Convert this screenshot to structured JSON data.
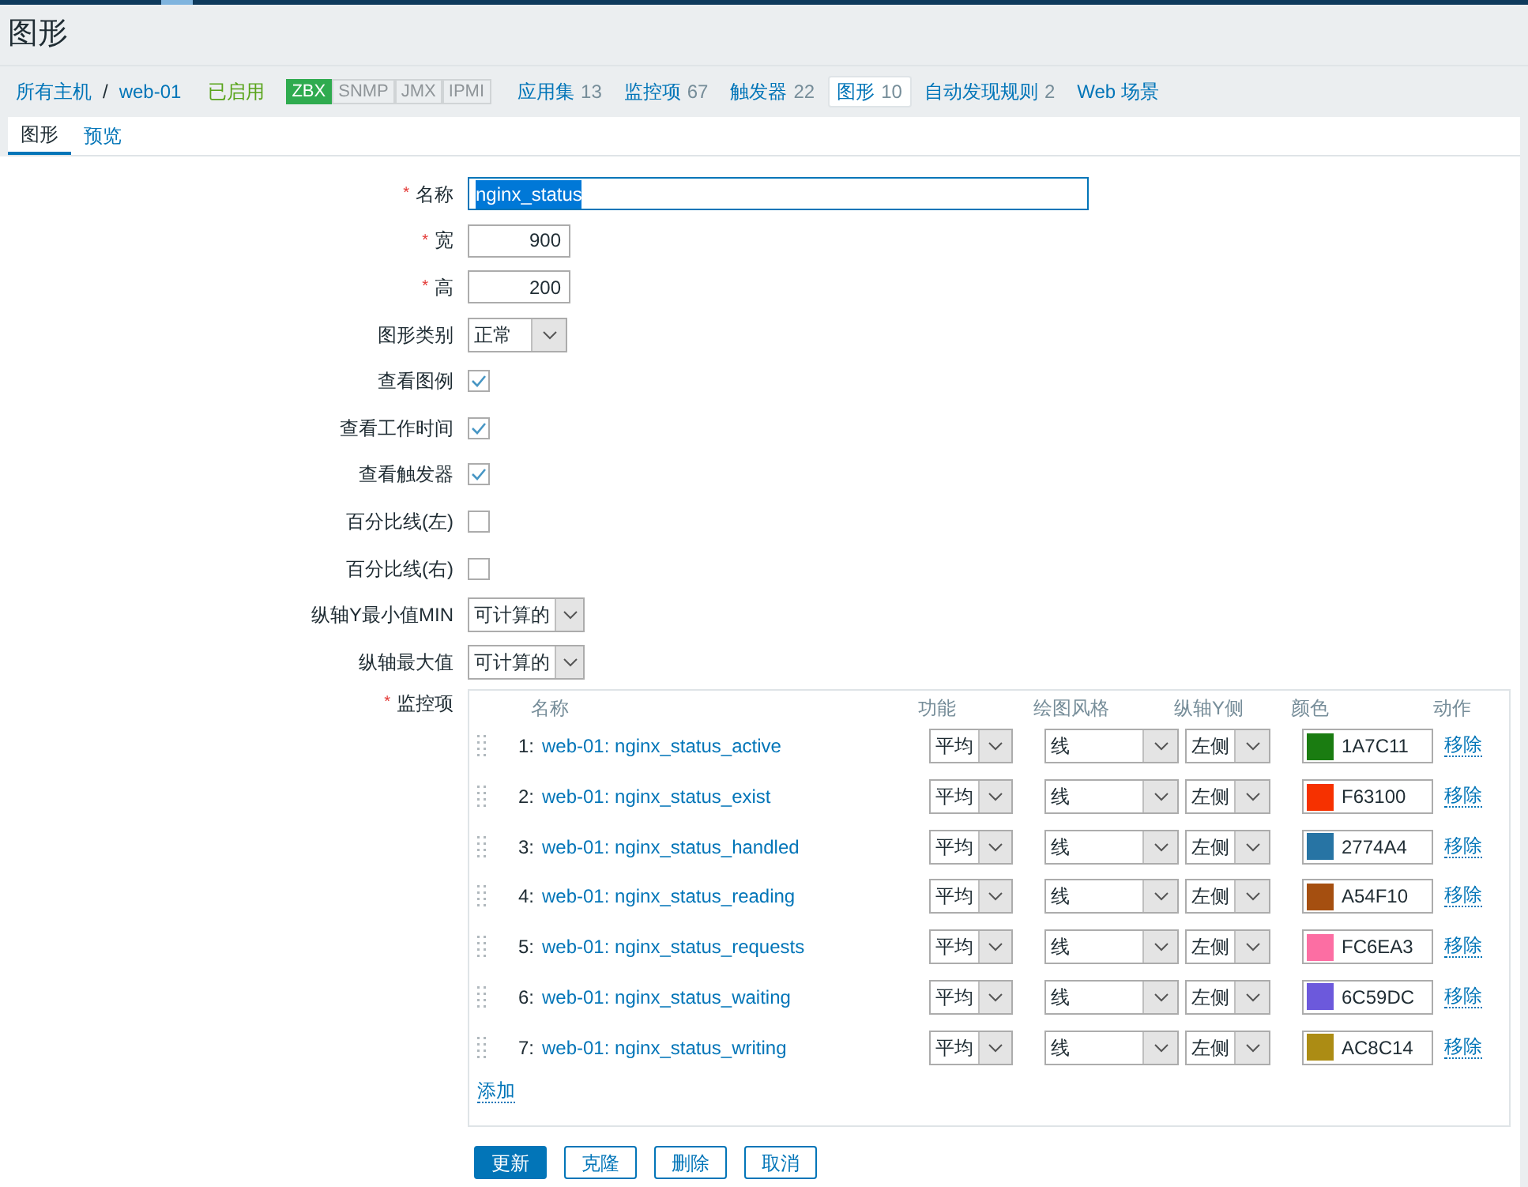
{
  "page_title": "图形",
  "required_mark": "*",
  "nav": {
    "breadcrumbs": [
      {
        "label": "所有主机"
      },
      {
        "label": "web-01"
      }
    ],
    "separator": "/",
    "status": "已启用",
    "availability": [
      {
        "label": "ZBX",
        "active": true
      },
      {
        "label": "SNMP",
        "active": false
      },
      {
        "label": "JMX",
        "active": false
      },
      {
        "label": "IPMI",
        "active": false
      }
    ],
    "links": [
      {
        "label": "应用集",
        "count": "13",
        "selected": false
      },
      {
        "label": "监控项",
        "count": "67",
        "selected": false
      },
      {
        "label": "触发器",
        "count": "22",
        "selected": false
      },
      {
        "label": "图形",
        "count": "10",
        "selected": true
      },
      {
        "label": "自动发现规则",
        "count": "2",
        "selected": false
      },
      {
        "label": "Web 场景",
        "selected": false
      }
    ]
  },
  "tabs": [
    {
      "label": "图形",
      "selected": true
    },
    {
      "label": "预览",
      "selected": false
    }
  ],
  "fields": [
    {
      "kind": "text",
      "label": "名称",
      "required": true,
      "value": "nginx_status",
      "highlighted": true
    },
    {
      "kind": "number",
      "label": "宽",
      "required": true,
      "value": "900",
      "highlighted": false
    },
    {
      "kind": "number",
      "label": "高",
      "required": true,
      "value": "200",
      "highlighted": false
    },
    {
      "kind": "select",
      "label": "图形类别",
      "required": false,
      "value": "正常"
    },
    {
      "kind": "checkbox",
      "label": "查看图例",
      "required": false,
      "checked": true
    },
    {
      "kind": "checkbox",
      "label": "查看工作时间",
      "required": false,
      "checked": true
    },
    {
      "kind": "checkbox",
      "label": "查看触发器",
      "required": false,
      "checked": true
    },
    {
      "kind": "checkbox",
      "label": "百分比线(左)",
      "required": false,
      "checked": false
    },
    {
      "kind": "checkbox",
      "label": "百分比线(右)",
      "required": false,
      "checked": false
    },
    {
      "kind": "select",
      "label": "纵轴Y最小值MIN",
      "required": false,
      "value": "可计算的"
    },
    {
      "kind": "select",
      "label": "纵轴最大值",
      "required": false,
      "value": "可计算的"
    }
  ],
  "items": {
    "label": "监控项",
    "required": true,
    "columns": [
      "名称",
      "功能",
      "绘图风格",
      "纵轴Y侧",
      "颜色",
      "动作"
    ],
    "rows": [
      {
        "index": "1:",
        "name": "web-01: nginx_status_active",
        "function": "平均",
        "style": "线",
        "axis": "左侧",
        "color": "#1a7c11",
        "color_code": "1A7C11",
        "action": "移除"
      },
      {
        "index": "2:",
        "name": "web-01: nginx_status_exist",
        "function": "平均",
        "style": "线",
        "axis": "左侧",
        "color": "#f63100",
        "color_code": "F63100",
        "action": "移除"
      },
      {
        "index": "3:",
        "name": "web-01: nginx_status_handled",
        "function": "平均",
        "style": "线",
        "axis": "左侧",
        "color": "#2774a4",
        "color_code": "2774A4",
        "action": "移除"
      },
      {
        "index": "4:",
        "name": "web-01: nginx_status_reading",
        "function": "平均",
        "style": "线",
        "axis": "左侧",
        "color": "#a54f10",
        "color_code": "A54F10",
        "action": "移除"
      },
      {
        "index": "5:",
        "name": "web-01: nginx_status_requests",
        "function": "平均",
        "style": "线",
        "axis": "左侧",
        "color": "#fc6ea3",
        "color_code": "FC6EA3",
        "action": "移除"
      },
      {
        "index": "6:",
        "name": "web-01: nginx_status_waiting",
        "function": "平均",
        "style": "线",
        "axis": "左侧",
        "color": "#6c59dc",
        "color_code": "6C59DC",
        "action": "移除"
      },
      {
        "index": "7:",
        "name": "web-01: nginx_status_writing",
        "function": "平均",
        "style": "线",
        "axis": "左侧",
        "color": "#ac8c14",
        "color_code": "AC8C14",
        "action": "移除"
      }
    ],
    "add": "添加"
  },
  "buttons": [
    {
      "label": "更新",
      "primary": true
    },
    {
      "label": "克隆",
      "primary": false
    },
    {
      "label": "删除",
      "primary": false
    },
    {
      "label": "取消",
      "primary": false
    }
  ]
}
